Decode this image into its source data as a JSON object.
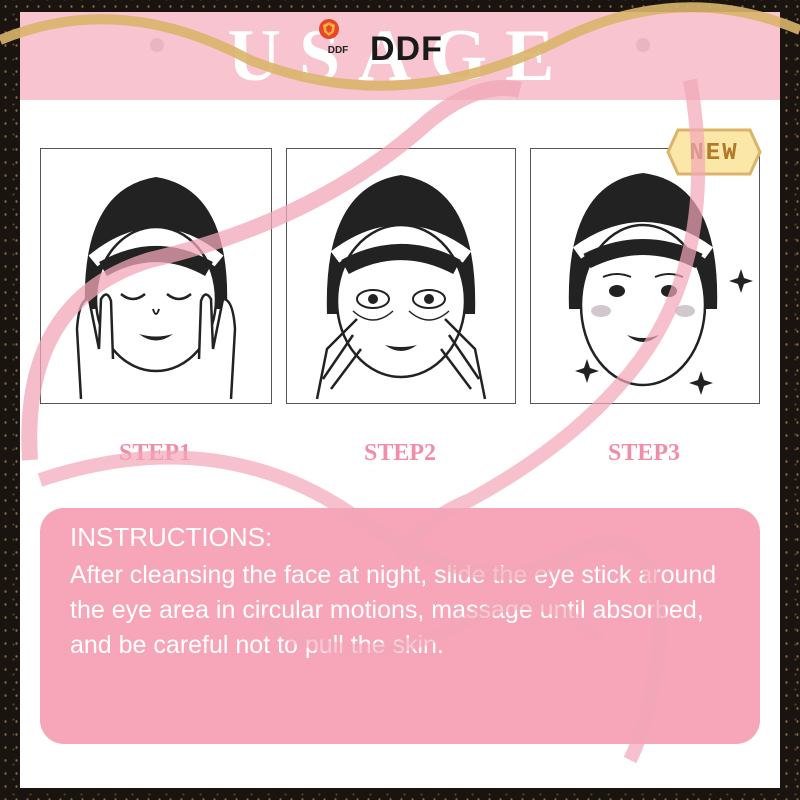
{
  "header": {
    "title": "USAGE",
    "brand": "DDF",
    "logo_text": "DDF"
  },
  "badge": {
    "label": "NEW"
  },
  "steps": [
    {
      "label": "STEP1",
      "face": "eyes-closed-hands-on-cheeks"
    },
    {
      "label": "STEP2",
      "face": "massaging-eye-area"
    },
    {
      "label": "STEP3",
      "face": "refreshed-with-sparkles"
    }
  ],
  "instructions": {
    "title": "INSTRUCTIONS:",
    "body": "After cleansing the face at night, slide the eye stick around the eye area in circular motions, massage until absorbed, and be careful not to pull the skin."
  },
  "colors": {
    "accent_pink": "#f28da8",
    "panel_pink": "#f6a6b8",
    "header_pink": "#f7c4cf",
    "ribbon": "#f2a7b8",
    "gold": "#d9b46a"
  }
}
